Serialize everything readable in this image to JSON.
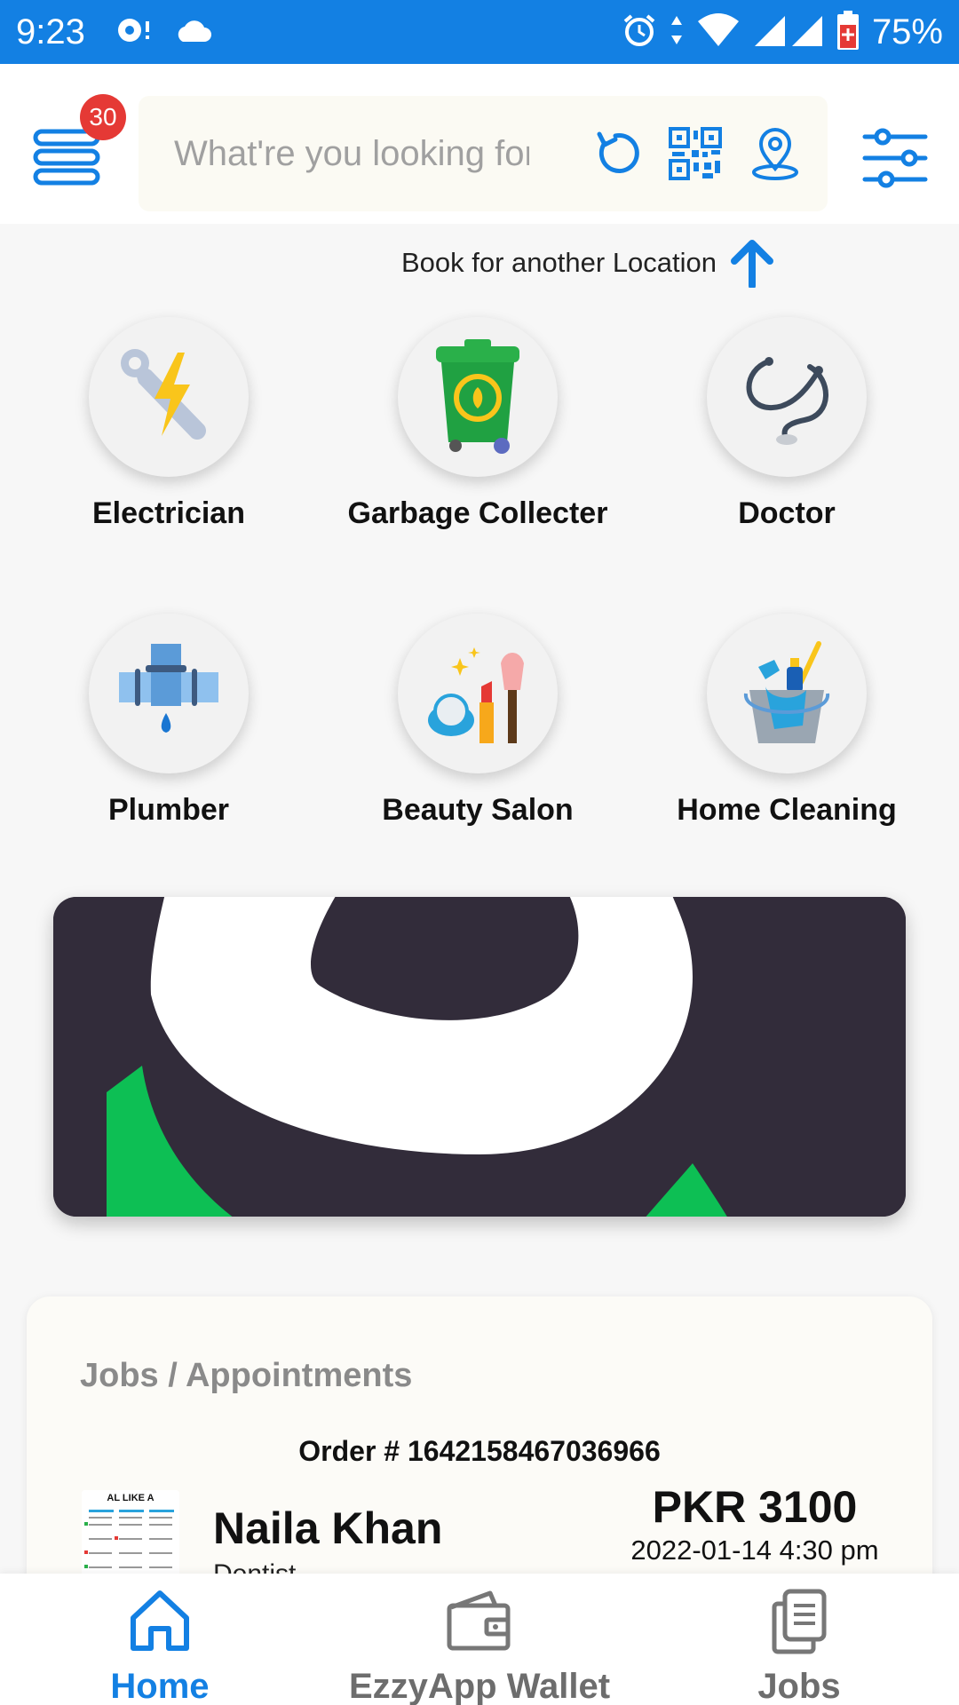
{
  "status_bar": {
    "time": "9:23",
    "battery": "75%",
    "icons": [
      "chat-notification-icon",
      "cloud-icon",
      "alarm-icon",
      "wifi-icon",
      "signal-icon",
      "battery-icon"
    ]
  },
  "header": {
    "menu_badge": "30",
    "search_placeholder": "What're you looking for",
    "icons": [
      "refresh-icon",
      "qr-code-icon",
      "location-pin-icon",
      "filter-sliders-icon"
    ],
    "accent_color": "#1380e3"
  },
  "book_location": "Book for another Location",
  "categories": [
    {
      "label": "Electrician",
      "icon": "wrench-bolt-icon"
    },
    {
      "label": "Garbage Collecter",
      "icon": "recycle-bin-icon"
    },
    {
      "label": "Doctor",
      "icon": "stethoscope-icon"
    },
    {
      "label": "Plumber",
      "icon": "pipe-icon"
    },
    {
      "label": "Beauty Salon",
      "icon": "makeup-icon"
    },
    {
      "label": "Home Cleaning",
      "icon": "cleaning-bucket-icon"
    }
  ],
  "jobs": {
    "title": "Jobs / Appointments",
    "order": "Order # 1642158467036966",
    "name": "Naila Khan",
    "profession": "Dentist",
    "price": "PKR 3100",
    "datetime": "2022-01-14 4:30 pm",
    "thumb_text": "...AL LIKE A..."
  },
  "bottom_nav": [
    {
      "label": "Home",
      "icon": "home-icon",
      "active": true
    },
    {
      "label": "EzzyApp Wallet",
      "icon": "wallet-icon",
      "active": false
    },
    {
      "label": "Jobs",
      "icon": "documents-icon",
      "active": false
    }
  ]
}
